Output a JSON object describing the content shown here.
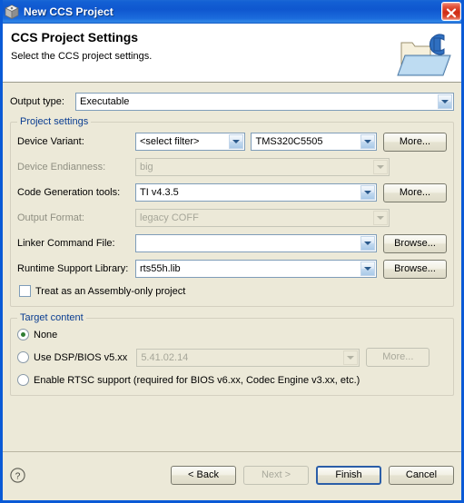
{
  "window": {
    "title": "New CCS Project",
    "title_icon": "cube-icon",
    "close_label": "close-icon"
  },
  "header": {
    "title": "CCS Project Settings",
    "subtitle": "Select the CCS project settings.",
    "icon": "ccs-folder-icon"
  },
  "output": {
    "label": "Output type:",
    "value": "Executable"
  },
  "project_settings": {
    "legend": "Project settings",
    "device_variant": {
      "label": "Device Variant:",
      "filter_value": "<select filter>",
      "device_value": "TMS320C5505",
      "more_label": "More..."
    },
    "device_endianness": {
      "label": "Device Endianness:",
      "value": "big"
    },
    "code_generation_tools": {
      "label": "Code Generation tools:",
      "value": "TI v4.3.5",
      "more_label": "More..."
    },
    "output_format": {
      "label": "Output Format:",
      "value": "legacy COFF"
    },
    "linker_command_file": {
      "label": "Linker Command File:",
      "value": "",
      "browse_label": "Browse..."
    },
    "runtime_support_library": {
      "label": "Runtime Support Library:",
      "value": "rts55h.lib",
      "browse_label": "Browse..."
    },
    "assembly_only": {
      "label": "Treat as an Assembly-only project",
      "checked": false
    }
  },
  "target_content": {
    "legend": "Target content",
    "options": [
      {
        "label": "None",
        "selected": true
      },
      {
        "label": "Use DSP/BIOS v5.xx",
        "selected": false
      },
      {
        "label": "Enable RTSC support (required for BIOS v6.xx, Codec Engine v3.xx, etc.)",
        "selected": false
      }
    ],
    "bios_version": "5.41.02.14",
    "bios_more_label": "More..."
  },
  "footer": {
    "help_icon": "help-icon",
    "back_label": "< Back",
    "next_label": "Next >",
    "finish_label": "Finish",
    "cancel_label": "Cancel"
  },
  "colors": {
    "titlebar_blue": "#0f57cf",
    "window_border": "#0a5ad6",
    "dialog_bg": "#ece9d8",
    "group_legend": "#0a3d91",
    "field_border": "#7f9db9",
    "default_button_border": "#2b5ea8",
    "radio_dot": "#2f7d32",
    "close_red": "#cf2a14"
  }
}
